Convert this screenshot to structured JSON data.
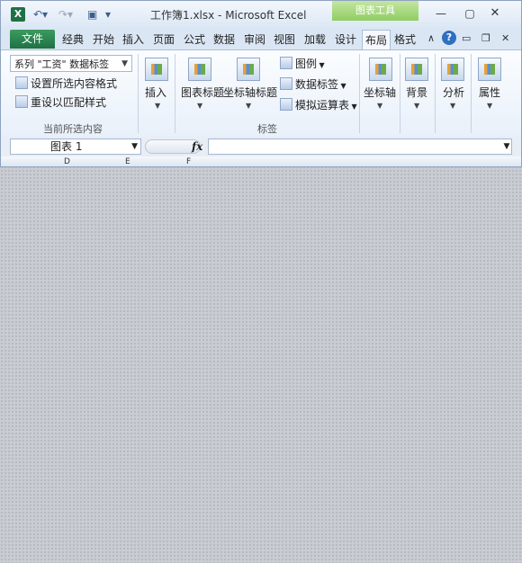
{
  "window": {
    "title": "工作簿1.xlsx  -  Microsoft Excel",
    "context_tab": "图表工具"
  },
  "tabs": {
    "file": "文件",
    "items": [
      "经典",
      "开始",
      "插入",
      "页面",
      "公式",
      "数据",
      "审阅",
      "视图",
      "加载",
      "设计"
    ],
    "active": "布局",
    "after": "格式"
  },
  "current_selection": {
    "combo_value": "系列 \"工资\" 数据标签",
    "format_selection": "设置所选内容格式",
    "reset_style": "重设以匹配样式",
    "group_label": "当前所选内容"
  },
  "insert": {
    "label": "插入"
  },
  "labels_group": {
    "chart_title": "图表标题",
    "axis_titles": "坐标轴标题",
    "legend": "图例",
    "data_labels": "数据标签",
    "data_table": "模拟运算表",
    "group_label": "标签"
  },
  "axes": {
    "label": "坐标轴"
  },
  "background": {
    "label": "背景"
  },
  "analysis": {
    "label": "分析"
  },
  "properties": {
    "label": "属性"
  },
  "formula_bar": {
    "name_box": "图表 1",
    "fx": "fx"
  },
  "columns": [
    "D",
    "E",
    "F"
  ]
}
